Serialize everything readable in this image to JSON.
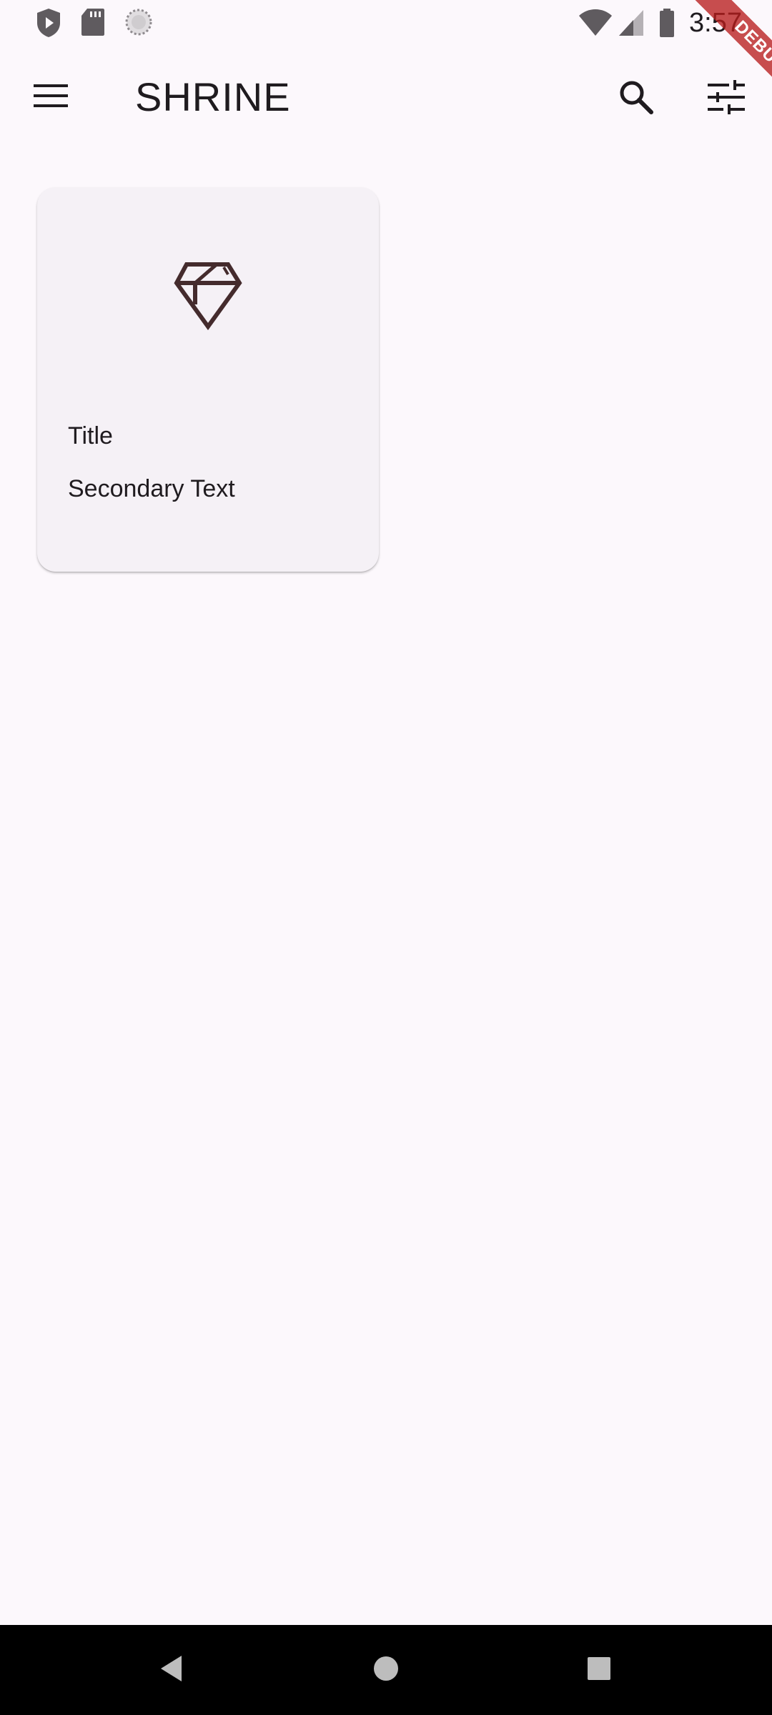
{
  "status_bar": {
    "time": "3:57",
    "left_icons": [
      "shield-play-icon",
      "sd-card-icon",
      "loading-icon"
    ],
    "right_icons": [
      "wifi-icon",
      "cell-signal-icon",
      "battery-icon"
    ]
  },
  "debug_banner": {
    "label": "DEBUG",
    "color": "#b71c1c"
  },
  "app_bar": {
    "title": "SHRINE",
    "menu_icon": "menu-icon",
    "search_icon": "search-icon",
    "filter_icon": "tune-icon"
  },
  "product_card": {
    "image_icon": "diamond-icon",
    "title": "Title",
    "secondary_text": "Secondary Text"
  },
  "nav_bar": {
    "icons": [
      "back-icon",
      "home-icon",
      "recents-icon"
    ]
  },
  "colors": {
    "background": "#fcf8fc",
    "card": "#f5f1f6",
    "icon_brown": "#442b2d",
    "text": "#1f1b1f"
  }
}
